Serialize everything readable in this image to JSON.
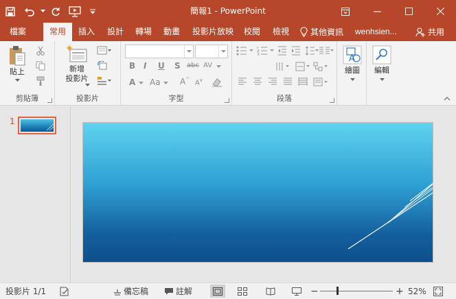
{
  "window": {
    "title": "簡報1 - PowerPoint",
    "titlebar_color": "#b7472a"
  },
  "qat": {
    "icons": [
      "save-icon",
      "undo-icon",
      "redo-icon",
      "present-from-beginning-icon",
      "customize-qat-icon"
    ]
  },
  "tabs": [
    {
      "label": "檔案"
    },
    {
      "label": "常用",
      "active": true
    },
    {
      "label": "插入"
    },
    {
      "label": "設計"
    },
    {
      "label": "轉場"
    },
    {
      "label": "動畫"
    },
    {
      "label": "投影片放映"
    },
    {
      "label": "校閱"
    },
    {
      "label": "檢視"
    }
  ],
  "tellme": {
    "label": "其他資訊",
    "icon": "lightbulb-icon"
  },
  "user": {
    "name": "wenhsien..."
  },
  "share": {
    "label": "共用",
    "icon": "add-person-icon"
  },
  "ribbon": {
    "clipboard": {
      "paste_label": "貼上",
      "group_label": "剪貼簿"
    },
    "slides": {
      "new_slide_label": "新增\n投影片",
      "new_slide_line1": "新增",
      "new_slide_line2": "投影片",
      "group_label": "投影片"
    },
    "font": {
      "group_label": "字型",
      "font_value": "",
      "size_value": ""
    },
    "paragraph": {
      "group_label": "段落"
    },
    "drawing": {
      "label": "繪圖"
    },
    "editing": {
      "label": "編輯"
    }
  },
  "thumbnails": [
    {
      "number": "1"
    }
  ],
  "statusbar": {
    "slide_info": "投影片 1/1",
    "notes_label": "備忘稿",
    "comments_label": "註解",
    "zoom_percent": "52%",
    "zoom_level": 0.52
  }
}
